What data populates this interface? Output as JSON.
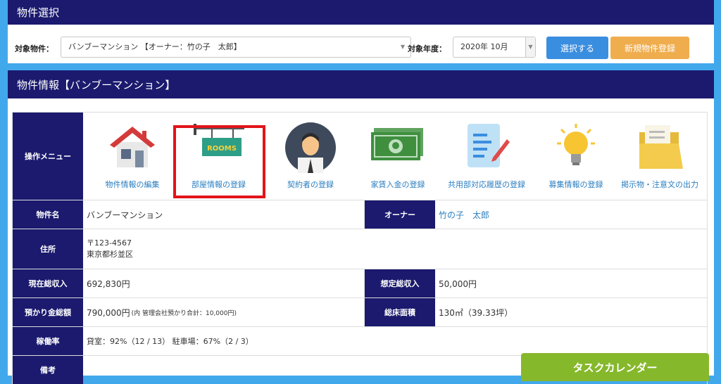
{
  "panel1": {
    "title": "物件選択",
    "property_label": "対象物件：",
    "property_value": "バンブーマンション 【オーナー：竹の子　太郎】",
    "year_label": "対象年度：",
    "year_value": "2020年 10月",
    "select_button": "選択する",
    "new_button": "新規物件登録"
  },
  "panel2": {
    "title": "物件情報【バンブーマンション】",
    "menu_label": "操作メニュー",
    "menu_items": [
      {
        "label": "物件情報の編集",
        "icon": "house-icon"
      },
      {
        "label": "部屋情報の登録",
        "icon": "rooms-sign-icon"
      },
      {
        "label": "契約者の登録",
        "icon": "person-icon"
      },
      {
        "label": "家賃入金の登録",
        "icon": "money-icon"
      },
      {
        "label": "共用部対応履歴の登録",
        "icon": "document-pen-icon"
      },
      {
        "label": "募集情報の登録",
        "icon": "lightbulb-icon"
      },
      {
        "label": "掲示物・注意文の出力",
        "icon": "folder-icon"
      }
    ],
    "rows": {
      "name_label": "物件名",
      "name_value": "バンブーマンション",
      "owner_label": "オーナー",
      "owner_value": "竹の子　太郎",
      "address_label": "住所",
      "address_line1": "〒123-4567",
      "address_line2": "東京都杉並区",
      "income_label": "現在総収入",
      "income_value": "692,830円",
      "expected_label": "想定総収入",
      "expected_value": "50,000円",
      "deposit_label": "預かり金総額",
      "deposit_value": "790,000円",
      "deposit_note": "(内 管理会社預かり合計：10,000円)",
      "floor_label": "総床面積",
      "floor_value": "130㎡（39.33坪）",
      "occupancy_label": "稼働率",
      "occupancy_value": "貸室：92%（12 / 13） 駐車場：67%（2 / 3）",
      "remarks_label": "備考"
    }
  },
  "task_calendar": "タスクカレンダー",
  "colors": {
    "navy": "#1b1a6e",
    "blue_button": "#3a8ee0",
    "orange_button": "#f0ad4e",
    "green": "#86b82b",
    "link": "#2a7ec0"
  }
}
